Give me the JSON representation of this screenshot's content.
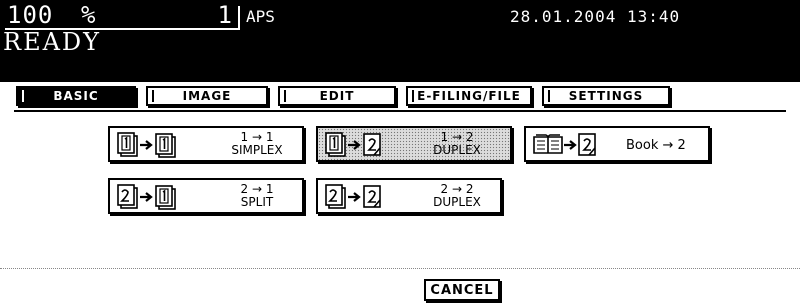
{
  "status": {
    "zoom_value": "100",
    "zoom_unit": "%",
    "copy_count": "1",
    "paper_mode": "APS",
    "datetime": "28.01.2004 13:40",
    "state": "READY"
  },
  "tabs": [
    {
      "label": "BASIC",
      "active": true
    },
    {
      "label": "IMAGE",
      "active": false
    },
    {
      "label": "EDIT",
      "active": false
    },
    {
      "label": "E-FILING/FILE",
      "active": false
    },
    {
      "label": "SETTINGS",
      "active": false
    }
  ],
  "modes": {
    "simplex_1_1": {
      "line1": "1 → 1",
      "line2": "SIMPLEX",
      "selected": false
    },
    "duplex_1_2": {
      "line1": "1 → 2",
      "line2": "DUPLEX",
      "selected": true
    },
    "book_2": {
      "line1": "Book → 2",
      "selected": false
    },
    "split_2_1": {
      "line1": "2 → 1",
      "line2": "SPLIT",
      "selected": false
    },
    "duplex_2_2": {
      "line1": "2 → 2",
      "line2": "DUPLEX",
      "selected": false
    }
  },
  "cancel_label": "CANCEL"
}
